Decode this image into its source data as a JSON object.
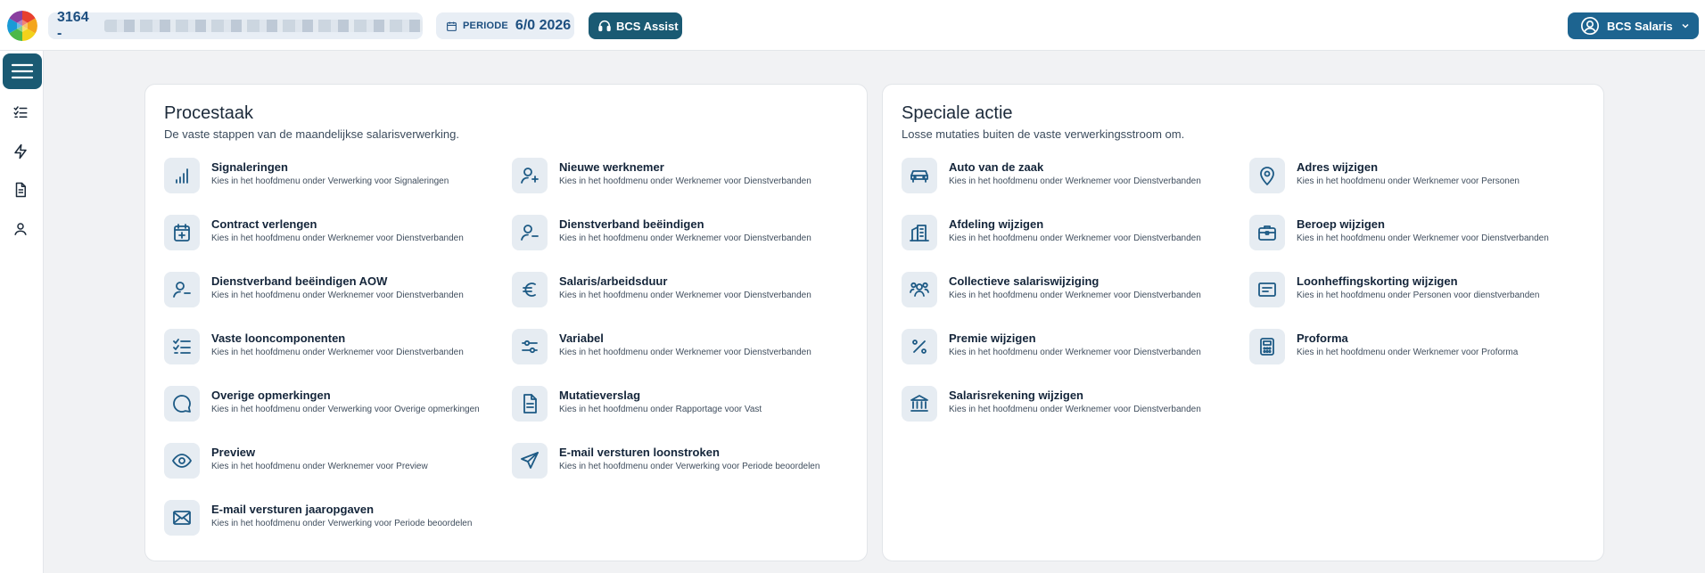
{
  "header": {
    "client_number": "3164 -",
    "period_label": "PERIODE",
    "period_value": "6/0 2026",
    "assist_label": "BCS Assist",
    "user_label": "BCS Salaris"
  },
  "sidebar": {
    "items": [
      {
        "icon": "checklist-icon"
      },
      {
        "icon": "lightning-icon"
      },
      {
        "icon": "document-icon"
      },
      {
        "icon": "person-icon"
      }
    ]
  },
  "procestaak": {
    "title": "Procestaak",
    "subtitle": "De vaste stappen van de maandelijkse salarisverwerking.",
    "items": [
      {
        "title": "Signaleringen",
        "desc": "Kies in het hoofdmenu onder Verwerking voor Signaleringen",
        "icon": "signal-bars-icon"
      },
      {
        "title": "Nieuwe werknemer",
        "desc": "Kies in het hoofdmenu onder Werknemer voor Dienstverbanden",
        "icon": "user-plus-icon"
      },
      {
        "title": "Contract verlengen",
        "desc": "Kies in het hoofdmenu onder Werknemer voor Dienstverbanden",
        "icon": "calendar-plus-icon"
      },
      {
        "title": "Dienstverband beëindigen",
        "desc": "Kies in het hoofdmenu onder Werknemer voor Dienstverbanden",
        "icon": "user-minus-icon"
      },
      {
        "title": "Dienstverband beëindigen AOW",
        "desc": "Kies in het hoofdmenu onder Werknemer voor Dienstverbanden",
        "icon": "user-minus-icon"
      },
      {
        "title": "Salaris/arbeidsduur",
        "desc": "Kies in het hoofdmenu onder Werknemer voor Dienstverbanden",
        "icon": "euro-icon"
      },
      {
        "title": "Vaste looncomponenten",
        "desc": "Kies in het hoofdmenu onder Werknemer voor Dienstverbanden",
        "icon": "checklist-icon"
      },
      {
        "title": "Variabel",
        "desc": "Kies in het hoofdmenu onder Werknemer voor Dienstverbanden",
        "icon": "sliders-icon"
      },
      {
        "title": "Overige opmerkingen",
        "desc": "Kies in het hoofdmenu onder Verwerking voor Overige opmerkingen",
        "icon": "chat-bubble-icon"
      },
      {
        "title": "Mutatieverslag",
        "desc": "Kies in het hoofdmenu onder Rapportage voor Vast",
        "icon": "document-icon"
      },
      {
        "title": "Preview",
        "desc": "Kies in het hoofdmenu onder Werknemer voor Preview",
        "icon": "eye-icon"
      },
      {
        "title": "E-mail versturen loonstroken",
        "desc": "Kies in het hoofdmenu onder Verwerking voor Periode beoordelen",
        "icon": "paper-plane-icon"
      },
      {
        "title": "E-mail versturen jaaropgaven",
        "desc": "Kies in het hoofdmenu onder Verwerking voor Periode beoordelen",
        "icon": "envelope-icon"
      }
    ]
  },
  "speciale_actie": {
    "title": "Speciale actie",
    "subtitle": "Losse mutaties buiten de vaste verwerkingsstroom om.",
    "items": [
      {
        "title": "Auto van de zaak",
        "desc": "Kies in het hoofdmenu onder Werknemer voor Dienstverbanden",
        "icon": "car-icon"
      },
      {
        "title": "Adres wijzigen",
        "desc": "Kies in het hoofdmenu onder Werknemer voor Personen",
        "icon": "map-pin-icon"
      },
      {
        "title": "Afdeling wijzigen",
        "desc": "Kies in het hoofdmenu onder Werknemer voor Dienstverbanden",
        "icon": "building-icon"
      },
      {
        "title": "Beroep wijzigen",
        "desc": "Kies in het hoofdmenu onder Werknemer voor Dienstverbanden",
        "icon": "briefcase-icon"
      },
      {
        "title": "Collectieve salariswijziging",
        "desc": "Kies in het hoofdmenu onder Werknemer voor Dienstverbanden",
        "icon": "group-icon"
      },
      {
        "title": "Loonheffingskorting wijzigen",
        "desc": "Kies in het hoofdmenu onder Personen voor dienstverbanden",
        "icon": "receipt-icon"
      },
      {
        "title": "Premie wijzigen",
        "desc": "Kies in het hoofdmenu onder Werknemer voor Dienstverbanden",
        "icon": "percent-icon"
      },
      {
        "title": "Proforma",
        "desc": "Kies in het hoofdmenu onder Werknemer voor Proforma",
        "icon": "calculator-icon"
      },
      {
        "title": "Salarisrekening wijzigen",
        "desc": "Kies in het hoofdmenu onder Werknemer voor Dienstverbanden",
        "icon": "bank-icon"
      }
    ]
  }
}
